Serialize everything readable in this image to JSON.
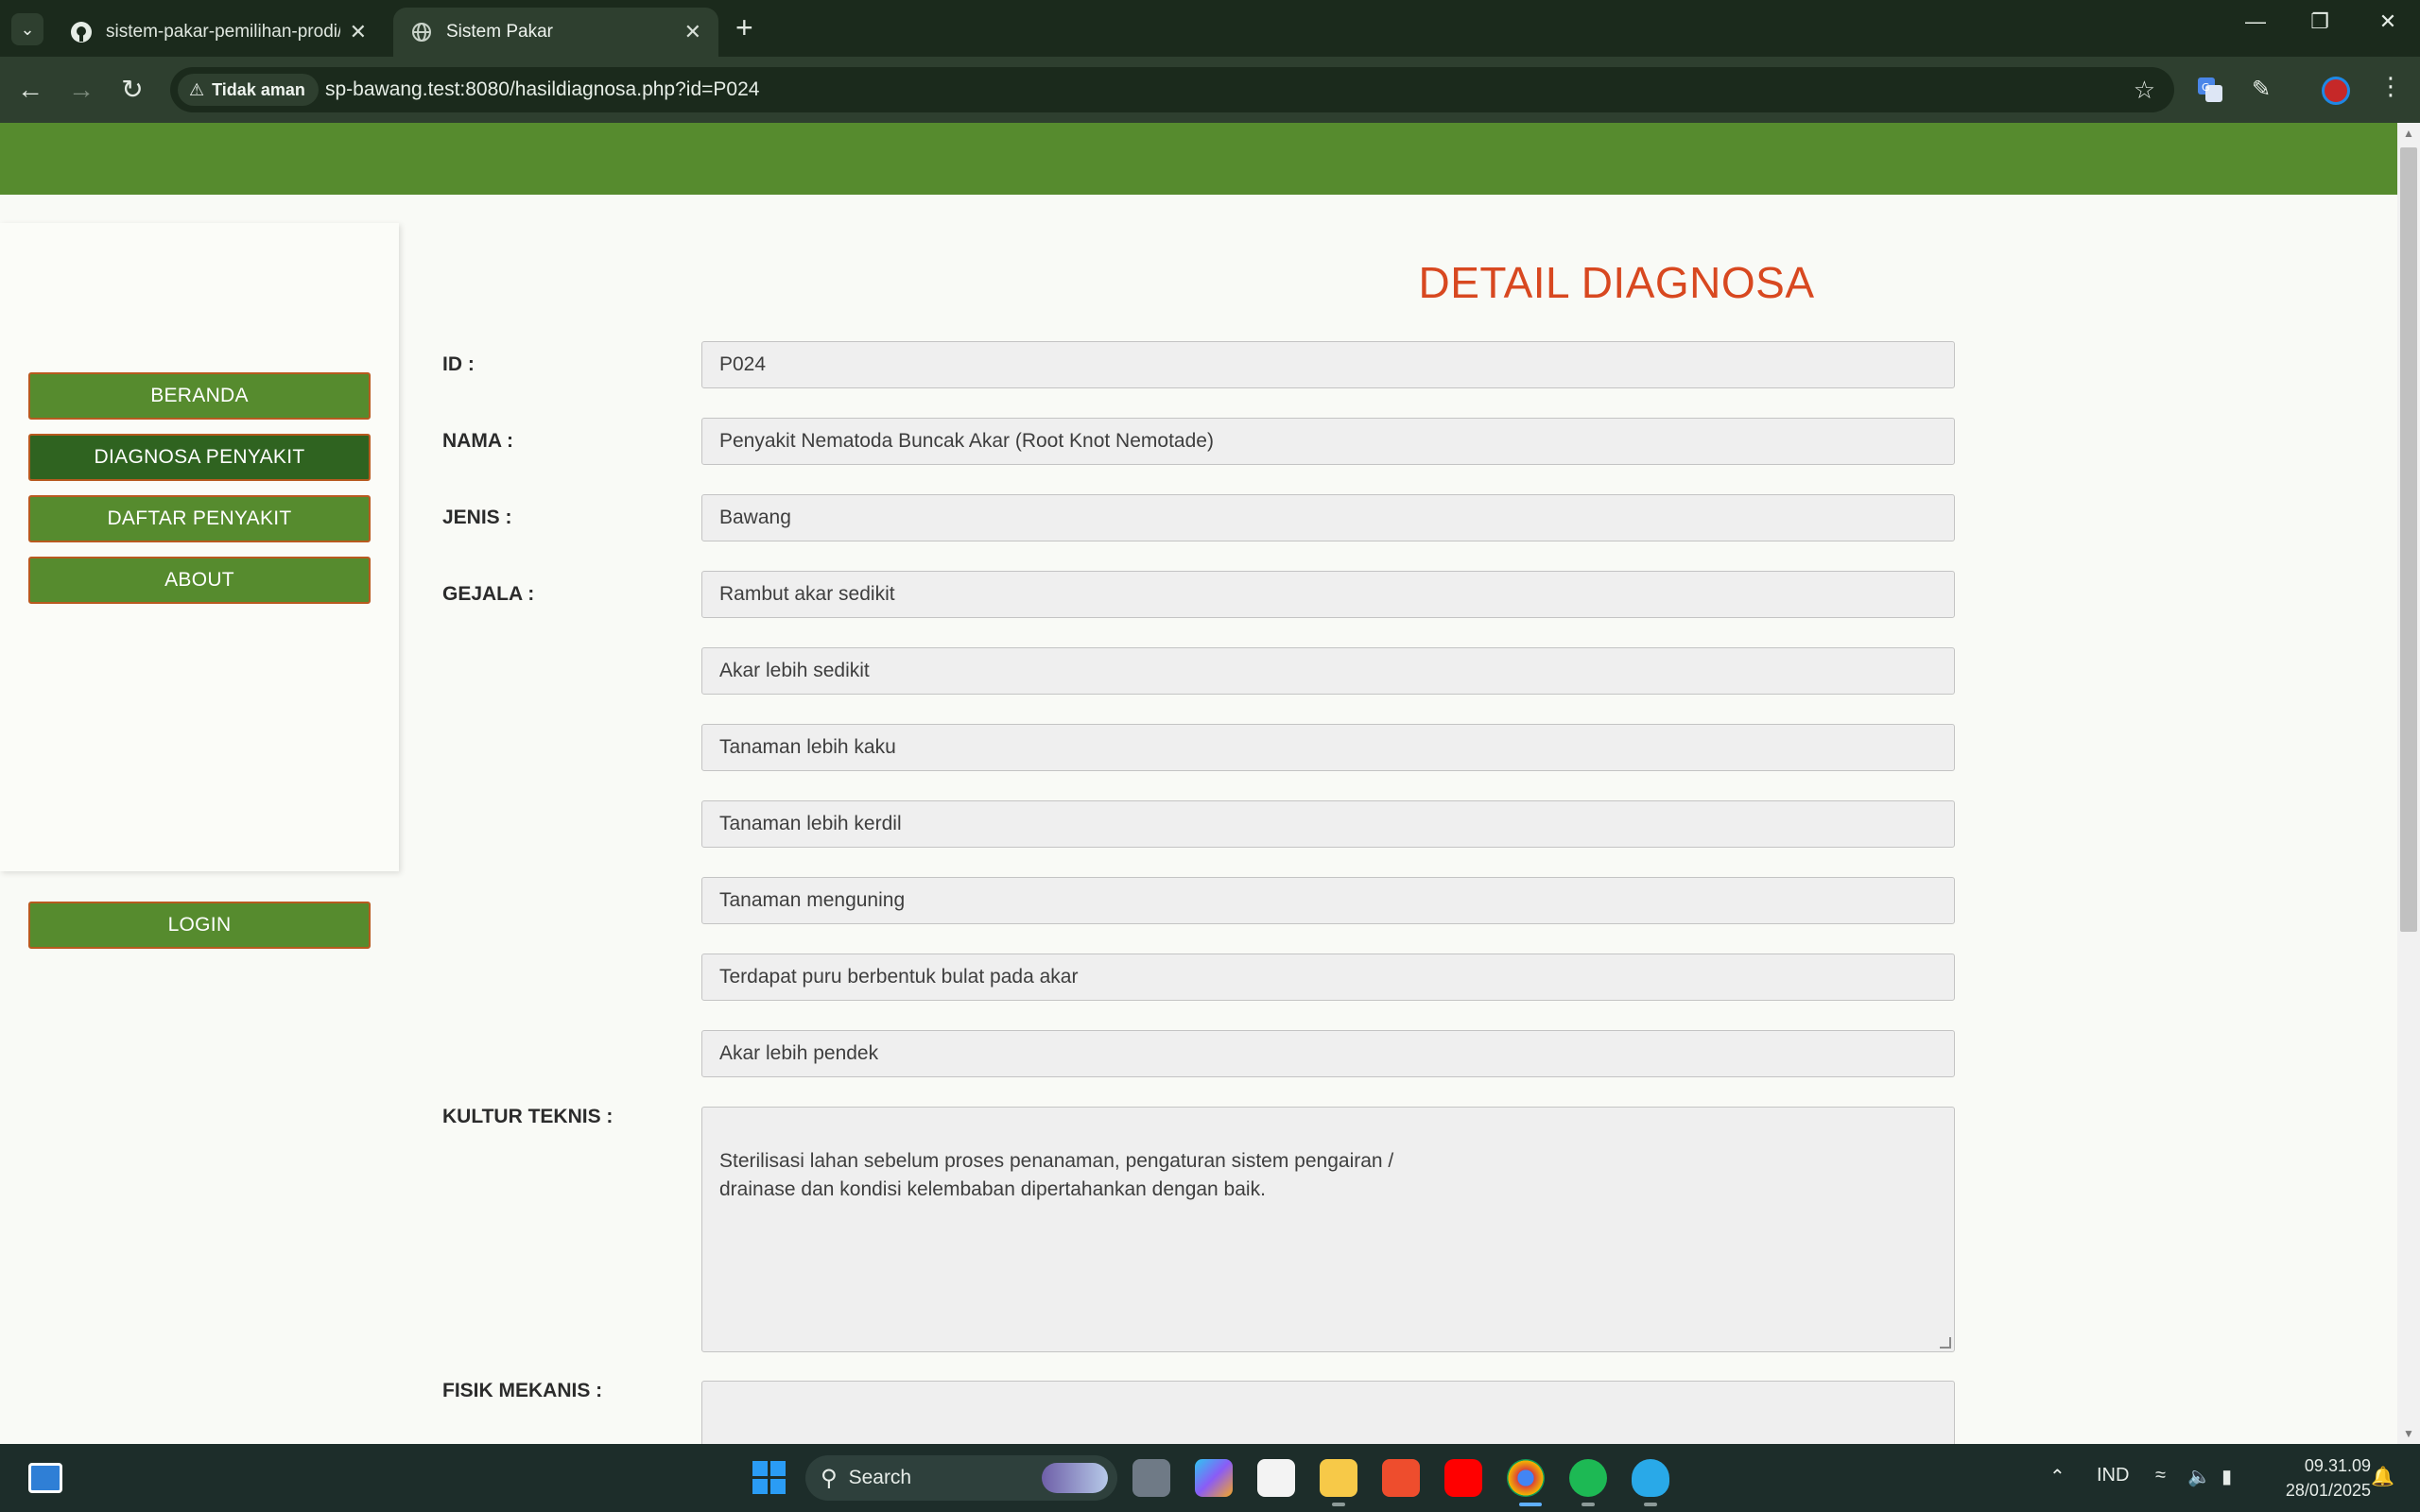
{
  "browser": {
    "tabs": [
      {
        "title": "sistem-pakar-pemilihan-prodi/",
        "active": false
      },
      {
        "title": "Sistem Pakar",
        "active": true
      }
    ],
    "security_label": "Tidak aman",
    "url": "sp-bawang.test:8080/hasildiagnosa.php?id=P024"
  },
  "sidebar": {
    "items": [
      {
        "label": "BERANDA"
      },
      {
        "label": "DIAGNOSA PENYAKIT"
      },
      {
        "label": "DAFTAR PENYAKIT"
      },
      {
        "label": "ABOUT"
      }
    ],
    "login_label": "LOGIN"
  },
  "page": {
    "title": "DETAIL DIAGNOSA",
    "labels": {
      "id": "ID :",
      "nama": "NAMA :",
      "jenis": "JENIS :",
      "gejala": "GEJALA :",
      "kultur": "KULTUR TEKNIS :",
      "fisik": "FISIK MEKANIS :"
    },
    "id": "P024",
    "nama": "Penyakit Nematoda Buncak Akar (Root Knot Nemotade)",
    "jenis": "Bawang",
    "gejala": [
      "Rambut akar sedikit",
      "Akar lebih sedikit",
      "Tanaman lebih kaku",
      "Tanaman lebih kerdil",
      "Tanaman menguning",
      "Terdapat puru berbentuk bulat pada akar",
      "Akar lebih pendek"
    ],
    "kultur_teknis": "Sterilisasi lahan sebelum proses penanaman, pengaturan sistem pengairan /\ndrainase dan kondisi kelembaban dipertahankan dengan baik.",
    "fisik_mekanis": ""
  },
  "taskbar": {
    "search_placeholder": "Search",
    "language": "IND",
    "time": "09.31.09",
    "date": "28/01/2025"
  }
}
